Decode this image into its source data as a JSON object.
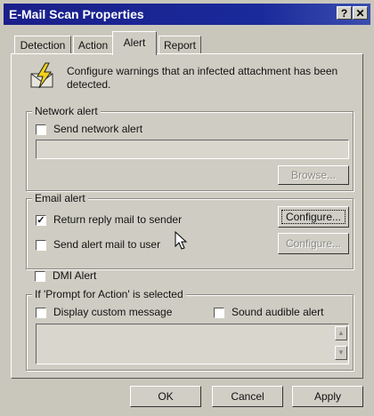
{
  "window": {
    "title": "E-Mail Scan Properties",
    "help_label": "?",
    "close_label": "✕"
  },
  "tabs": [
    {
      "label": "Detection"
    },
    {
      "label": "Action"
    },
    {
      "label": "Alert",
      "active": true
    },
    {
      "label": "Report"
    }
  ],
  "intro": {
    "icon": "lightning-alert-icon",
    "text_line1": "Configure warnings that an infected attachment has been",
    "text_line2": "detected."
  },
  "network_alert": {
    "group_label": "Network alert",
    "send_label": "Send network alert",
    "send_checked": false,
    "field_value": "",
    "browse_label": "Browse..."
  },
  "email_alert": {
    "group_label": "Email alert",
    "reply_label": "Return reply mail to sender",
    "reply_checked": true,
    "reply_configure_label": "Configure...",
    "user_label": "Send alert mail to user",
    "user_checked": false,
    "user_configure_label": "Configure..."
  },
  "dmi_alert": {
    "label": "DMI Alert",
    "checked": false
  },
  "prompt_group": {
    "group_label": "If 'Prompt for Action' is selected",
    "display_label": "Display custom message",
    "display_checked": false,
    "sound_label": "Sound audible alert",
    "sound_checked": false,
    "message_value": ""
  },
  "footer": {
    "ok_label": "OK",
    "cancel_label": "Cancel",
    "apply_label": "Apply"
  },
  "colors": {
    "titlebar": "#1a1f8a",
    "face": "#cfcdc3"
  }
}
